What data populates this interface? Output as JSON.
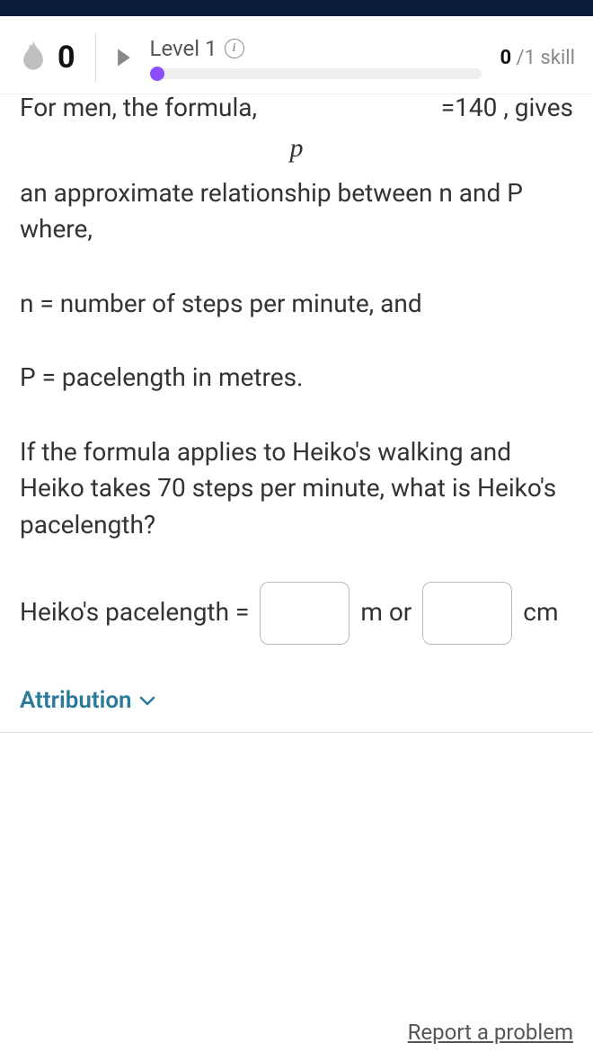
{
  "header": {
    "streak": "0",
    "level_label": "Level 1",
    "skill_bold": "0",
    "skill_rest": " /1 skill"
  },
  "question": {
    "clipped_left": "For men, the formula,",
    "clipped_right": "=140 , gives",
    "frac_denom": "p",
    "line1": "an approximate relationship between n and P where,",
    "line2": "n = number of steps per minute, and",
    "line3": "P = pacelength in metres.",
    "line4": "If the formula applies to Heiko's walking and Heiko takes 70 steps per minute, what is Heiko's pacelength?",
    "answer_prefix": "Heiko's pacelength =",
    "answer_mid": "m or",
    "answer_suffix": "cm"
  },
  "footer": {
    "attribution": "Attribution",
    "report": "Report a problem"
  }
}
